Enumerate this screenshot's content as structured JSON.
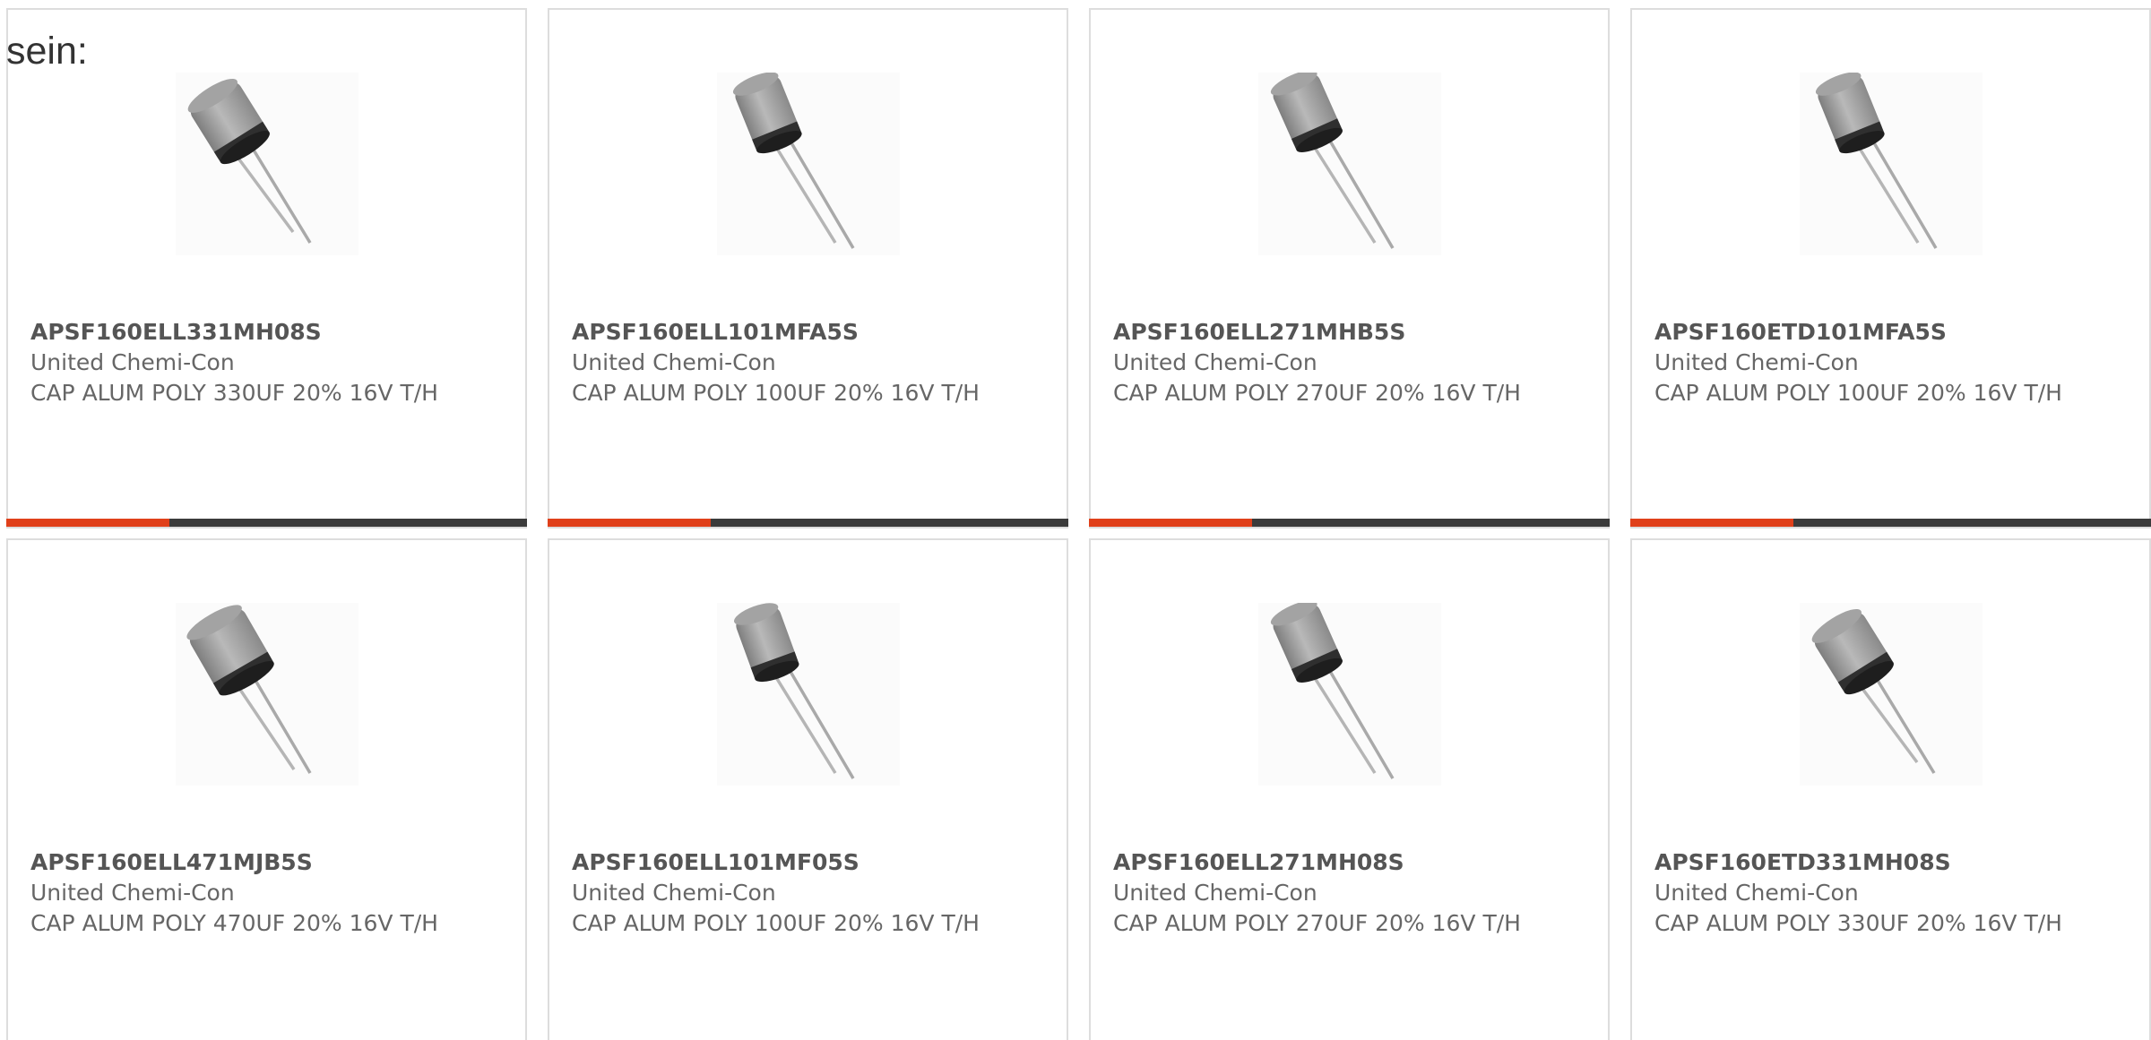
{
  "intro": {
    "text": "sein:"
  },
  "products": [
    {
      "part_number": "APSF160ELL331MH08S",
      "manufacturer": "United Chemi-Con",
      "description": "CAP ALUM POLY 330UF 20% 16V T/H",
      "image_icon": "capacitor-radial-icon",
      "accent_color": "#e0401a",
      "bar_color": "#3b3b3b"
    },
    {
      "part_number": "APSF160ELL101MFA5S",
      "manufacturer": "United Chemi-Con",
      "description": "CAP ALUM POLY 100UF 20% 16V T/H",
      "image_icon": "capacitor-radial-icon",
      "accent_color": "#e0401a",
      "bar_color": "#3b3b3b"
    },
    {
      "part_number": "APSF160ELL271MHB5S",
      "manufacturer": "United Chemi-Con",
      "description": "CAP ALUM POLY 270UF 20% 16V T/H",
      "image_icon": "capacitor-radial-icon",
      "accent_color": "#e0401a",
      "bar_color": "#3b3b3b"
    },
    {
      "part_number": "APSF160ETD101MFA5S",
      "manufacturer": "United Chemi-Con",
      "description": "CAP ALUM POLY 100UF 20% 16V T/H",
      "image_icon": "capacitor-radial-icon",
      "accent_color": "#e0401a",
      "bar_color": "#3b3b3b"
    },
    {
      "part_number": "APSF160ELL471MJB5S",
      "manufacturer": "United Chemi-Con",
      "description": "CAP ALUM POLY 470UF 20% 16V T/H",
      "image_icon": "capacitor-radial-icon"
    },
    {
      "part_number": "APSF160ELL101MF05S",
      "manufacturer": "United Chemi-Con",
      "description": "CAP ALUM POLY 100UF 20% 16V T/H",
      "image_icon": "capacitor-radial-icon"
    },
    {
      "part_number": "APSF160ELL271MH08S",
      "manufacturer": "United Chemi-Con",
      "description": "CAP ALUM POLY 270UF 20% 16V T/H",
      "image_icon": "capacitor-radial-icon"
    },
    {
      "part_number": "APSF160ETD331MH08S",
      "manufacturer": "United Chemi-Con",
      "description": "CAP ALUM POLY 330UF 20% 16V T/H",
      "image_icon": "capacitor-radial-icon"
    }
  ]
}
